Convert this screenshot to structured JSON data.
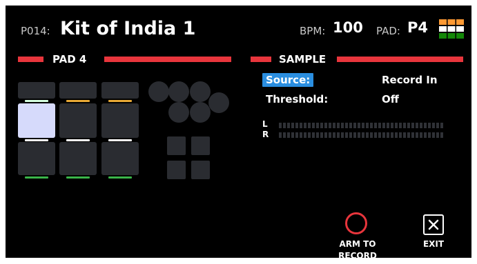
{
  "header": {
    "preset_id": "P014:",
    "kit_name": "Kit of India 1",
    "bpm_label": "BPM:",
    "bpm_value": "100",
    "pad_label": "PAD:",
    "pad_value": "P4",
    "flag_icon": "india-flag-grid-icon",
    "flag_colors": [
      "#ff9933",
      "#ffffff",
      "#138808"
    ]
  },
  "pad_section": {
    "title": "PAD 4",
    "selected_pad": 4,
    "pads": [
      {
        "number": 1,
        "lit": false,
        "strip_color": "#d6ffe0"
      },
      {
        "number": 2,
        "lit": false,
        "strip_color": "#e9a935"
      },
      {
        "number": 3,
        "lit": false,
        "strip_color": "#e9a935"
      },
      {
        "number": 4,
        "lit": true,
        "strip_color": "#ffffff"
      },
      {
        "number": 5,
        "lit": false,
        "strip_color": "#ffffff"
      },
      {
        "number": 6,
        "lit": false,
        "strip_color": "#ffffff"
      },
      {
        "number": 7,
        "lit": false,
        "strip_color": "#3ab54a"
      },
      {
        "number": 8,
        "lit": false,
        "strip_color": "#3ab54a"
      },
      {
        "number": 9,
        "lit": false,
        "strip_color": "#3ab54a"
      }
    ]
  },
  "sample_section": {
    "title": "SAMPLE",
    "params": [
      {
        "label": "Source:",
        "value": "Record In",
        "selected": true
      },
      {
        "label": "Threshold:",
        "value": "Off",
        "selected": false
      }
    ],
    "meter": {
      "left_label": "L",
      "right_label": "R",
      "left_level": 0,
      "right_level": 0
    }
  },
  "actions": {
    "arm_label_line1": "ARM TO",
    "arm_label_line2": "RECORD",
    "exit_label": "EXIT"
  },
  "colors": {
    "accent_red": "#e8353c",
    "selection_blue": "#2a8ee0",
    "pad_dark": "#2a2c31",
    "pad_lit": "#d6dafb",
    "strip_orange": "#e9a935",
    "strip_green": "#3ab54a"
  }
}
